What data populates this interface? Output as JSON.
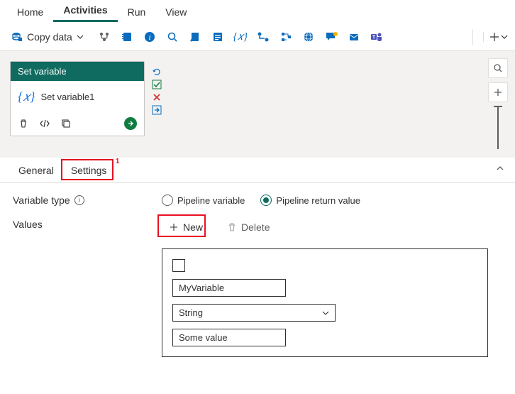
{
  "nav": {
    "tabs": [
      "Home",
      "Activities",
      "Run",
      "View"
    ],
    "active": 1
  },
  "toolbar": {
    "copy_label": "Copy data"
  },
  "activity": {
    "header": "Set variable",
    "name": "Set variable1"
  },
  "detail_tabs": {
    "general": "General",
    "settings": "Settings",
    "badge": "1"
  },
  "form": {
    "variable_type_label": "Variable type",
    "radio_pipeline_var": "Pipeline variable",
    "radio_return_val": "Pipeline return value",
    "values_label": "Values",
    "new_label": "New",
    "delete_label": "Delete"
  },
  "value_entry": {
    "name": "MyVariable",
    "type": "String",
    "value": "Some value"
  }
}
